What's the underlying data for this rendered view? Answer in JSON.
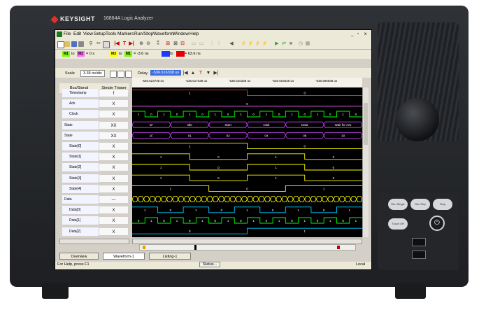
{
  "brand": "KEYSIGHT",
  "model": "16864A Logic Analyzer",
  "window": {
    "icon": "app-icon",
    "controls": [
      "_",
      "▫",
      "x"
    ]
  },
  "menus": [
    "File",
    "Edit",
    "View",
    "Setup",
    "Tools",
    "Markers",
    "Run/Stop",
    "Waveform",
    "Window",
    "Help"
  ],
  "markers": [
    {
      "from": "M1",
      "to": "M2",
      "value": "= 0 s",
      "from_color": "#7cfc00",
      "to_color": "#ff66ff"
    },
    {
      "from": "M3",
      "to": "M1",
      "value": "= -3.6 ns",
      "from_color": "#ffff00",
      "to_color": "#7cfc00"
    },
    {
      "from": "",
      "to": "",
      "value": "= 63.6 ns",
      "from_color": "#1a3cff",
      "to_color": "#e00000",
      "joiner": "to"
    }
  ],
  "scale": {
    "label": "Scale",
    "value": "3.35 ns/div"
  },
  "delay": {
    "label": "Delay",
    "value": "-536.616338 us"
  },
  "timeline_ticks": [
    "-536.623738 us",
    "-536.617038 us",
    "-536.610338 us",
    "-536.603638 us",
    "-536.596938 us"
  ],
  "columns": {
    "bus_signal": "Bus/Signal",
    "simple_trigger": "Simple Trigger"
  },
  "rows": [
    {
      "name": "Timestamp",
      "trigger": "f",
      "values": [
        "1",
        "0"
      ],
      "color": "#ff3030"
    },
    {
      "name": "Ack",
      "trigger": "X",
      "values": [
        "0"
      ],
      "color": "#ff66ff"
    },
    {
      "name": "Clock",
      "trigger": "X",
      "values": [
        "1",
        "0",
        "1",
        "0",
        "1",
        "0",
        "1",
        "0",
        "1",
        "0",
        "1",
        "0",
        "1",
        "0",
        "1",
        "0",
        "1",
        "0"
      ],
      "color": "#00ff00"
    },
    {
      "name": "State",
      "trigger": "XX",
      "values": [
        "1F",
        "Idle",
        "Start",
        "Addr",
        "Data",
        "Wait for Ack"
      ],
      "color": "#cc44ff",
      "bus": true
    },
    {
      "name": "State",
      "trigger": "XX",
      "values": [
        "1F",
        "01",
        "02",
        "04",
        "08",
        "10"
      ],
      "color": "#cc44ff",
      "bus": true
    },
    {
      "name": "State[0]",
      "trigger": "X",
      "values": [
        "1",
        "0"
      ],
      "color": "#ffff00"
    },
    {
      "name": "State[1]",
      "trigger": "X",
      "values": [
        "1",
        "0",
        "1",
        "0"
      ],
      "color": "#ffff00"
    },
    {
      "name": "State[2]",
      "trigger": "X",
      "values": [
        "1",
        "0",
        "1",
        "0"
      ],
      "color": "#ffff00"
    },
    {
      "name": "State[3]",
      "trigger": "X",
      "values": [
        "1",
        "0",
        "1",
        "0"
      ],
      "color": "#ffff00"
    },
    {
      "name": "State[4]",
      "trigger": "X",
      "values": [
        "1",
        "0",
        "1"
      ],
      "color": "#ffff00"
    },
    {
      "name": "Data",
      "trigger": "---",
      "values": [],
      "color": "#ffff00",
      "bus": true
    },
    {
      "name": "Data[0]",
      "trigger": "X",
      "values": [
        "1",
        "0",
        "1",
        "0",
        "1",
        "0",
        "1",
        "0",
        "1"
      ],
      "color": "#00ccff"
    },
    {
      "name": "Data[1]",
      "trigger": "X",
      "values": [
        "0",
        "1",
        "0",
        "1",
        "0",
        "1",
        "0",
        "1",
        "0",
        "1",
        "0",
        "1",
        "0",
        "1",
        "0",
        "1",
        "0",
        "1"
      ],
      "color": "#00ff00"
    },
    {
      "name": "Data[2]",
      "trigger": "X",
      "values": [
        "0",
        "1"
      ],
      "color": "#00ccff"
    }
  ],
  "tabs": [
    "Overview",
    "Waveform-1",
    "Listing-1"
  ],
  "status": {
    "help": "For Help, press F1",
    "center": "Status...",
    "right": "Local"
  },
  "hw_buttons": [
    "Run Single",
    "Run Rep",
    "Stop",
    "Touch Off"
  ],
  "power_symbol": "⏻"
}
